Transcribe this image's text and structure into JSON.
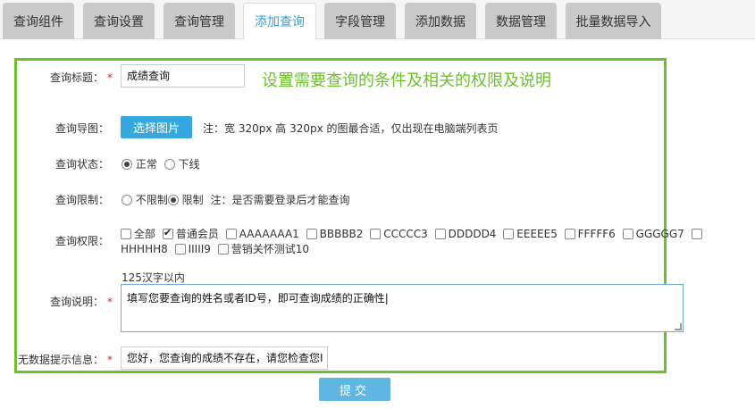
{
  "tabs": [
    {
      "label": "查询组件",
      "active": false
    },
    {
      "label": "查询设置",
      "active": false
    },
    {
      "label": "查询管理",
      "active": false
    },
    {
      "label": "添加查询",
      "active": true
    },
    {
      "label": "字段管理",
      "active": false
    },
    {
      "label": "添加数据",
      "active": false
    },
    {
      "label": "数据管理",
      "active": false
    },
    {
      "label": "批量数据导入",
      "active": false
    }
  ],
  "form": {
    "title_label": "查询标题：",
    "required_mark": "*",
    "title_value": "成绩查询",
    "green_note": "设置需要查询的条件及相关的权限及说明",
    "image_label": "查询导图：",
    "image_button": "选择图片",
    "image_note": "注：宽 320px 高 320px 的图最合适，仅出现在电脑端列表页",
    "status_label": "查询状态：",
    "status_options": [
      "正常",
      "下线"
    ],
    "status_selected": "正常",
    "limit_label": "查询限制：",
    "limit_options": [
      "不限制",
      "限制"
    ],
    "limit_selected": "限制",
    "limit_note": "注：是否需要登录后才能查询",
    "perm_label": "查询权限：",
    "perm_options": [
      {
        "label": "全部",
        "checked": false
      },
      {
        "label": "普通会员",
        "checked": true
      },
      {
        "label": "AAAAAAA1",
        "checked": false
      },
      {
        "label": "BBBBB2",
        "checked": false
      },
      {
        "label": "CCCCC3",
        "checked": false
      },
      {
        "label": "DDDDD4",
        "checked": false
      },
      {
        "label": "EEEEE5",
        "checked": false
      },
      {
        "label": "FFFFF6",
        "checked": false
      },
      {
        "label": "GGGGG7",
        "checked": false
      },
      {
        "label": "HHHHH8",
        "checked": false
      },
      {
        "label": "IIIII9",
        "checked": false
      },
      {
        "label": "营销关怀测试10",
        "checked": false
      }
    ],
    "desc_hint": "125汉字以内",
    "desc_label": "查询说明：",
    "desc_value": "填写您要查询的姓名或者ID号，即可查询成绩的正确性|",
    "nodata_label": "无数据提示信息：",
    "nodata_value": "您好，您查询的成绩不存在，请您检查您I",
    "submit_label": "提交"
  },
  "colors": {
    "accent": "#2aa3e0",
    "green": "#6cc12e",
    "button": "#35a8e0",
    "required": "#e02020"
  }
}
